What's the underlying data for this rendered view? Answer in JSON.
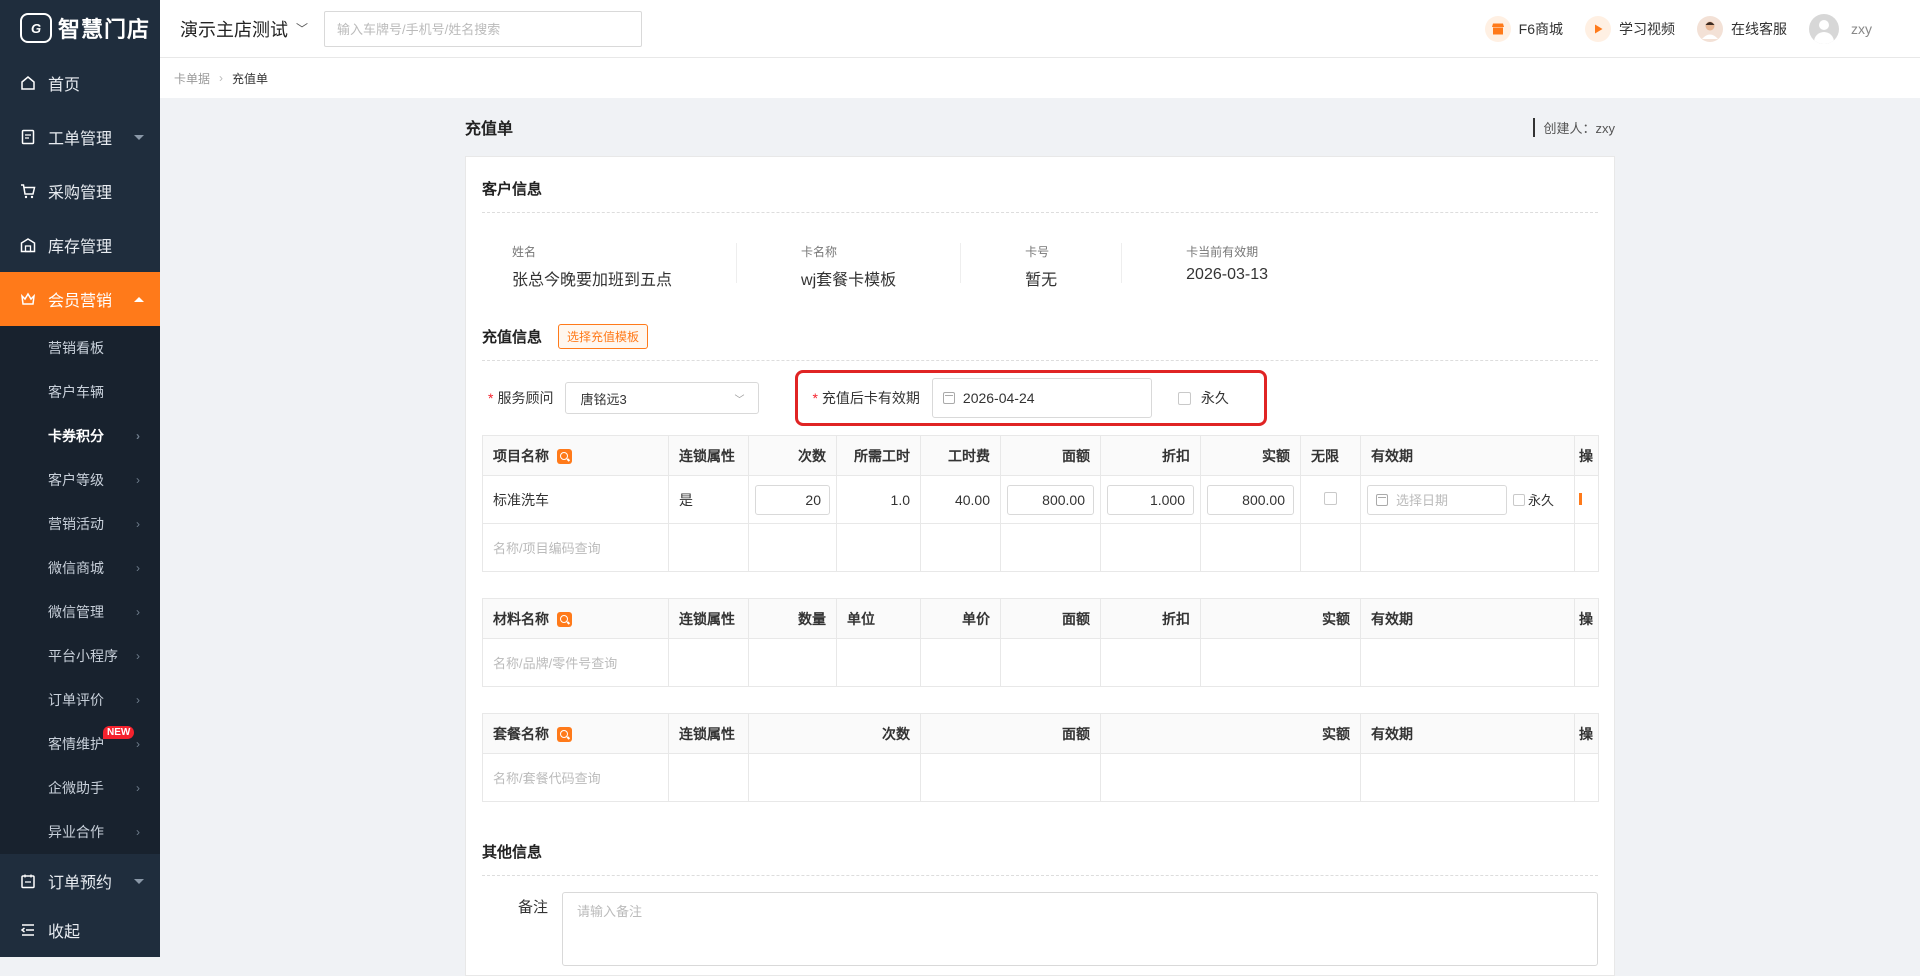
{
  "brand": {
    "logo_mark": "G",
    "name": "智慧门店"
  },
  "nav": {
    "items": [
      {
        "label": "首页",
        "icon": "home-icon"
      },
      {
        "label": "工单管理",
        "icon": "workorder-icon",
        "has_caret": true
      },
      {
        "label": "采购管理",
        "icon": "cart-icon"
      },
      {
        "label": "库存管理",
        "icon": "warehouse-icon"
      },
      {
        "label": "会员营销",
        "icon": "crown-icon",
        "active": true
      }
    ],
    "sub_items": [
      {
        "label": "营销看板"
      },
      {
        "label": "客户车辆"
      },
      {
        "label": "卡券积分",
        "bold": true
      },
      {
        "label": "客户等级"
      },
      {
        "label": "营销活动"
      },
      {
        "label": "微信商城"
      },
      {
        "label": "微信管理"
      },
      {
        "label": "平台小程序"
      },
      {
        "label": "订单评价"
      },
      {
        "label": "客情维护",
        "badge": "NEW"
      },
      {
        "label": "企微助手"
      },
      {
        "label": "异业合作"
      }
    ],
    "bottom": [
      {
        "label": "订单预约",
        "icon": "calendar-icon"
      },
      {
        "label": "收起",
        "icon": "collapse-icon"
      }
    ]
  },
  "header": {
    "store_name": "演示主店测试",
    "search_placeholder": "输入车牌号/手机号/姓名搜索",
    "shop_label": "F6商城",
    "video_label": "学习视频",
    "support_label": "在线客服",
    "user_name": "zxy"
  },
  "breadcrumb": {
    "parent": "卡单据",
    "current": "充值单"
  },
  "page": {
    "title": "充值单",
    "creator_label": "创建人：",
    "creator": "zxy"
  },
  "customer": {
    "section_title": "客户信息",
    "fields": [
      {
        "label": "姓名",
        "value": "张总今晚要加班到五点"
      },
      {
        "label": "卡名称",
        "value": "wj套餐卡模板"
      },
      {
        "label": "卡号",
        "value": "暂无"
      },
      {
        "label": "卡当前有效期",
        "value": "2026-03-13"
      }
    ]
  },
  "recharge": {
    "section_title": "充值信息",
    "template_button": "选择充值模板",
    "advisor_label": "服务顾问",
    "advisor_value": "唐铭远3",
    "expiry_label": "充值后卡有效期",
    "expiry_value": "2026-04-24",
    "forever_label": "永久"
  },
  "project_table": {
    "headers": [
      "项目名称",
      "连锁属性",
      "次数",
      "所需工时",
      "工时费",
      "面额",
      "折扣",
      "实额",
      "无限",
      "有效期",
      "操"
    ],
    "row": {
      "name": "标准洗车",
      "chain": "是",
      "count": "20",
      "hours": "1.0",
      "fee": "40.00",
      "face": "800.00",
      "discount": "1.000",
      "actual": "800.00",
      "date_placeholder": "选择日期",
      "forever": "永久"
    },
    "search_placeholder": "名称/项目编码查询"
  },
  "material_table": {
    "headers": [
      "材料名称",
      "连锁属性",
      "数量",
      "单位",
      "单价",
      "面额",
      "折扣",
      "实额",
      "有效期",
      "操"
    ],
    "search_placeholder": "名称/品牌/零件号查询"
  },
  "package_table": {
    "headers": [
      "套餐名称",
      "连锁属性",
      "次数",
      "面额",
      "实额",
      "有效期",
      "操"
    ],
    "search_placeholder": "名称/套餐代码查询"
  },
  "other": {
    "section_title": "其他信息",
    "remark_label": "备注",
    "remark_placeholder": "请输入备注"
  },
  "colors": {
    "accent": "#ff7a1a",
    "sidebar": "#1f2d3d",
    "highlight_border": "#e02424"
  }
}
